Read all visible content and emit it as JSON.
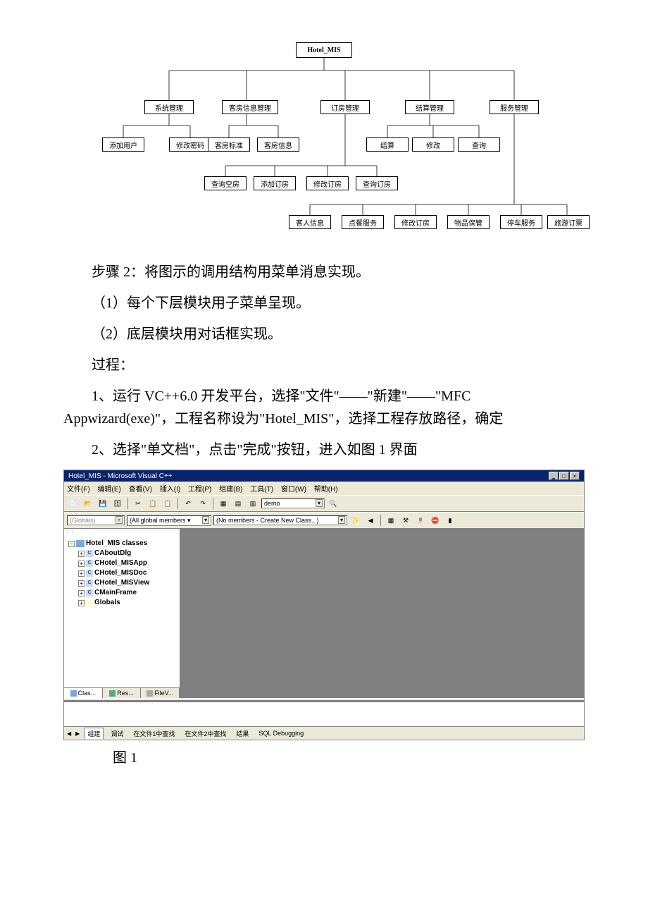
{
  "diagram": {
    "root": "Hotel_MIS",
    "level1": {
      "sys": "系统管理",
      "room": "客房信息管理",
      "book": "订房管理",
      "settle": "结算管理",
      "service": "服务管理"
    },
    "sys_children": {
      "adduser": "添加用户",
      "chpwd": "修改密码"
    },
    "room_children": {
      "std": "客房标准",
      "info": "客房信息"
    },
    "settle_children": {
      "settle": "结算",
      "modify": "修改",
      "query": "查询"
    },
    "book_children": {
      "qempty": "查询空房",
      "addbook": "添加订房",
      "modbook": "修改订房",
      "qbook": "查询订房"
    },
    "service_children": {
      "guest": "客人信息",
      "meal": "点餐服务",
      "modbook2": "修改订房",
      "goods": "物品保管",
      "park": "停车服务",
      "tour": "旅游订票"
    }
  },
  "body": {
    "step2": "步骤 2：将图示的调用结构用菜单消息实现。",
    "sub1": "（1）每个下层模块用子菜单呈现。",
    "sub2": "（2）底层模块用对话框实现。",
    "process": "过程：",
    "p1": "1、运行 VC++6.0 开发平台，选择\"文件\"——\"新建\"——\"MFC Appwizard(exe)\"，工程名称设为\"Hotel_MIS\"，选择工程存放路径，确定",
    "p2": "2、选择\"单文档\"，点击\"完成\"按钮，进入如图 1 界面",
    "fig1": "图 1"
  },
  "screenshot": {
    "title": "Hotel_MIS - Microsoft Visual C++",
    "menus": [
      "文件(F)",
      "编辑(E)",
      "查看(V)",
      "插入(I)",
      "工程(P)",
      "组建(B)",
      "工具(T)",
      "窗口(W)",
      "帮助(H)"
    ],
    "combo_class": "(Globals)",
    "combo_members": "(All global members ▾",
    "combo_create": "(No members - Create New Class...)",
    "demo_combo": "demo",
    "tree": {
      "root": "Hotel_MIS classes",
      "items": [
        "CAboutDlg",
        "CHotel_MISApp",
        "CHotel_MISDoc",
        "CHotel_MISView",
        "CMainFrame",
        "Globals"
      ]
    },
    "sidebar_tabs": {
      "class": "Clas...",
      "res": "Res...",
      "file": "FileV..."
    },
    "bottom_tabs": [
      "组建",
      "调试",
      "在文件1中查找",
      "在文件2中查找",
      "结果",
      "SQL Debugging"
    ]
  }
}
